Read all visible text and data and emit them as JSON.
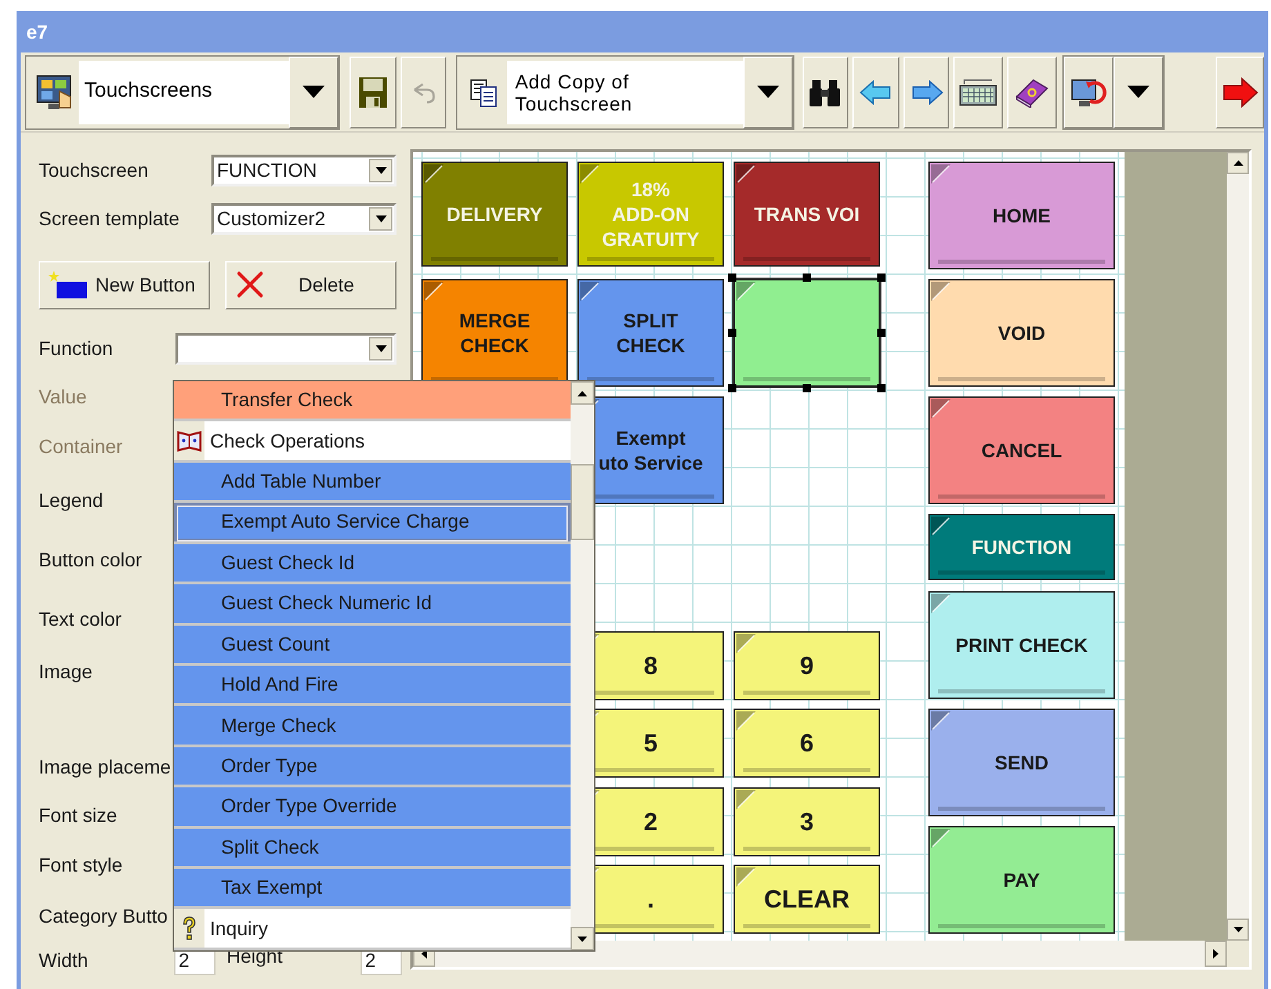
{
  "window": {
    "title": "e7"
  },
  "toolbar": {
    "module_selector": {
      "value": "Touchscreens"
    },
    "undo": {
      "disabled": true
    },
    "action_selector": {
      "lines": [
        "Add Copy of",
        "Touchscreen"
      ]
    }
  },
  "form": {
    "touchscreen": {
      "label": "Touchscreen",
      "value": "FUNCTION"
    },
    "screen_template": {
      "label": "Screen template",
      "value": "Customizer2"
    },
    "buttons": [
      {
        "label": "New Button",
        "kind": "new"
      },
      {
        "label": "Delete",
        "kind": "delete"
      }
    ],
    "function": {
      "label": "Function"
    },
    "properties": [
      {
        "label": "Value",
        "disabled": true
      },
      {
        "label": "Container",
        "disabled": true
      },
      {
        "label": "Legend",
        "disabled": false
      },
      {
        "label": "Button color",
        "disabled": false
      },
      {
        "label": "Text color",
        "disabled": false
      },
      {
        "label": "Image",
        "disabled": false
      },
      {
        "label": "Image placeme",
        "disabled": false
      },
      {
        "label": "Font size",
        "disabled": false
      },
      {
        "label": "Font style",
        "disabled": false
      },
      {
        "label": "Category Butto",
        "disabled": false
      }
    ],
    "width": {
      "label": "Width",
      "value": "2"
    },
    "height": {
      "label": "Height",
      "value": "2"
    }
  },
  "function_dropdown": {
    "items": [
      {
        "label": "Transfer Check",
        "kind": "item",
        "color": "#ffa07a",
        "selected": false
      },
      {
        "label": "Check Operations",
        "kind": "category"
      },
      {
        "label": "Add Table Number",
        "kind": "item",
        "color": "#6495ed",
        "selected": false
      },
      {
        "label": "Exempt Auto Service Charge",
        "kind": "item",
        "color": "#6495ed",
        "selected": true
      },
      {
        "label": "Guest Check Id",
        "kind": "item",
        "color": "#6495ed",
        "selected": false
      },
      {
        "label": "Guest Check Numeric Id",
        "kind": "item",
        "color": "#6495ed",
        "selected": false
      },
      {
        "label": "Guest Count",
        "kind": "item",
        "color": "#6495ed",
        "selected": false
      },
      {
        "label": "Hold And Fire",
        "kind": "item",
        "color": "#6495ed",
        "selected": false
      },
      {
        "label": "Merge Check",
        "kind": "item",
        "color": "#6495ed",
        "selected": false
      },
      {
        "label": "Order Type",
        "kind": "item",
        "color": "#6495ed",
        "selected": false
      },
      {
        "label": "Order Type Override",
        "kind": "item",
        "color": "#6495ed",
        "selected": false
      },
      {
        "label": "Split Check",
        "kind": "item",
        "color": "#6495ed",
        "selected": false
      },
      {
        "label": "Tax Exempt",
        "kind": "item",
        "color": "#6495ed",
        "selected": false
      },
      {
        "label": "Inquiry",
        "kind": "category"
      }
    ]
  },
  "canvas": {
    "buttons": [
      {
        "legend": [
          "DELIVERY"
        ],
        "color": "#808000",
        "selected": false
      },
      {
        "legend": [
          "18%",
          "ADD-ON",
          "GRATUITY"
        ],
        "color": "#c8c800",
        "selected": false
      },
      {
        "legend": [
          "TRANS VOI"
        ],
        "color": "#a52a2a",
        "selected": false
      },
      {
        "legend": [
          "MERGE",
          "CHECK"
        ],
        "color": "#f58400",
        "selected": false
      },
      {
        "legend": [
          "SPLIT",
          "CHECK"
        ],
        "color": "#6495ed",
        "selected": false
      },
      {
        "color": "#90ee90",
        "selected": true
      },
      {
        "legend": [
          "Exempt",
          "uto Service"
        ],
        "color": "#6495ed",
        "selected": false
      },
      {
        "legend": [
          "8"
        ],
        "color": "#f4f47a",
        "selected": false
      },
      {
        "legend": [
          "9"
        ],
        "color": "#f4f47a",
        "selected": false
      },
      {
        "legend": [
          "5"
        ],
        "color": "#f4f47a",
        "selected": false
      },
      {
        "legend": [
          "6"
        ],
        "color": "#f4f47a",
        "selected": false
      },
      {
        "legend": [
          "2"
        ],
        "color": "#f4f47a",
        "selected": false
      },
      {
        "legend": [
          "3"
        ],
        "color": "#f4f47a",
        "selected": false
      },
      {
        "legend": [
          "."
        ],
        "color": "#f4f47a",
        "selected": false
      },
      {
        "legend": [
          "CLEAR"
        ],
        "color": "#f4f47a",
        "selected": false
      },
      {
        "legend": [
          "HOME"
        ],
        "color": "#d89ad6",
        "selected": false
      },
      {
        "legend": [
          "VOID"
        ],
        "color": "#ffdbae",
        "selected": false
      },
      {
        "legend": [
          "CANCEL"
        ],
        "color": "#f38282",
        "selected": false
      },
      {
        "legend": [
          "FUNCTION"
        ],
        "color": "#007b7b",
        "selected": false
      },
      {
        "legend": [
          "PRINT CHECK"
        ],
        "color": "#afeeee",
        "selected": false
      },
      {
        "legend": [
          "SEND"
        ],
        "color": "#9ab0ec",
        "selected": false
      },
      {
        "legend": [
          "PAY"
        ],
        "color": "#93ec93",
        "selected": false
      }
    ]
  }
}
